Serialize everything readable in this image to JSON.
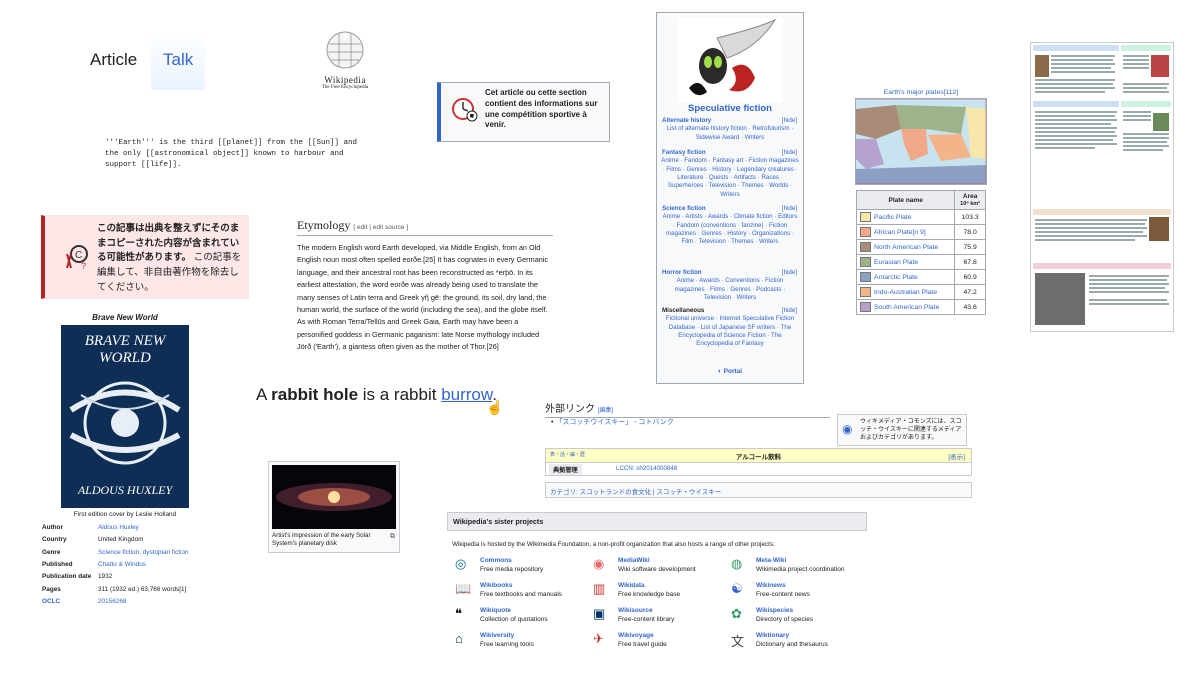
{
  "tabs": {
    "article": "Article",
    "talk": "Talk"
  },
  "wp_logo": {
    "name": "Wikipedia",
    "tagline": "The Free Encyclopedia"
  },
  "wikitext": "'''Earth''' is the third [[planet]] from the [[Sun]] and\nthe only [[astronomical object]] known to harbour and\nsupport [[life]].",
  "fr_notice": "Cet article ou cette section contient des informations sur une compétition sportive à venir.",
  "jp_notice": {
    "line1": "この記事は出典を整えずにそのままコピーされた内容が含まれている可能性があります。",
    "line2": "この記事を編集して、非自由著作物を除去してください。"
  },
  "etymology": {
    "heading": "Etymology",
    "edit": "[ edit | edit source ]",
    "text": "The modern English word Earth developed, via Middle English, from an Old English noun most often spelled eorðe.[25] It has cognates in every Germanic language, and their ancestral root has been reconstructed as *erþō. In its earliest attestation, the word eorðe was already being used to translate the many senses of Latin terra and Greek γῆ gē: the ground, its soil, dry land, the human world, the surface of the world (including the sea), and the globe itself. As with Roman Terra/Tellūs and Greek Gaia, Earth may have been a personified goddess in Germanic paganism: late Norse mythology included Jörð ('Earth'), a giantess often given as the mother of Thor.[26]"
  },
  "book": {
    "title": "Brave New World",
    "cover_top": "BRAVE NEW WORLD",
    "cover_author": "ALDOUS HUXLEY",
    "caption": "First edition cover by Leslie Holland",
    "rows": [
      {
        "k": "Author",
        "v": "Aldous Huxley",
        "link": true
      },
      {
        "k": "Country",
        "v": "United Kingdom",
        "link": false
      },
      {
        "k": "Genre",
        "v": "Science fiction, dystopian fiction",
        "link": true
      },
      {
        "k": "Published",
        "v": "Chatto & Windus",
        "link": true
      },
      {
        "k": "Publication date",
        "v": "1932",
        "link": false
      },
      {
        "k": "Pages",
        "v": "311 (1932 ed.) 63,766 words[1]",
        "link": false
      },
      {
        "k": "OCLC",
        "v": "20156268",
        "link": true
      }
    ]
  },
  "navbox": {
    "title": "Speculative fiction",
    "hide": "[hide]",
    "sections": [
      {
        "head": "Alternate history",
        "body": "List of alternate history fiction · Retrofuturism · Sidewise Award · Writers"
      },
      {
        "head": "Fantasy fiction",
        "body": "Anime · Fandom · Fantasy art · Fiction magazines · Films · Genres · History · Legendary creatures · Literature · Quests · Artifacts · Races · Superheroes · Television · Themes · Worlds · Writers"
      },
      {
        "head": "Science fiction",
        "body": "Anime · Artists · Awards · Climate fiction · Editors · Fandom (conventions · fanzine) · Fiction magazines · Genres · History · Organizations · Film · Television · Themes · Writers"
      },
      {
        "head": "Horror fiction",
        "body": "Anime · Awards · Conventions · Fiction magazines · Films · Genres · Podcasts · Television · Writers"
      },
      {
        "head": "Miscellaneous",
        "body": "Fictional universe · Internet Speculative Fiction Database · List of Japanese SF writers · The Encyclopedia of Science Fiction · The Encyclopedia of Fantasy"
      }
    ],
    "portal": "Portal"
  },
  "plates": {
    "caption": "Earth's major plates[112]",
    "col1": "Plate name",
    "col2": "Area",
    "col2_unit": "10⁶ km²",
    "rows": [
      {
        "name": "Pacific Plate",
        "area": "103.3",
        "color": "#f8e7a8"
      },
      {
        "name": "African Plate[n 9]",
        "area": "78.0",
        "color": "#f0a889"
      },
      {
        "name": "North American Plate",
        "area": "75.9",
        "color": "#a88c78"
      },
      {
        "name": "Eurasian Plate",
        "area": "67.8",
        "color": "#9fb38b"
      },
      {
        "name": "Antarctic Plate",
        "area": "60.9",
        "color": "#8c9fc4"
      },
      {
        "name": "Indo-Australian Plate",
        "area": "47.2",
        "color": "#f2b488"
      },
      {
        "name": "South American Plate",
        "area": "43.6",
        "color": "#b5a2cf"
      }
    ]
  },
  "rabbit": {
    "pre": "A ",
    "bold": "rabbit hole",
    "mid": " is a rabbit ",
    "link": "burrow",
    "post": "."
  },
  "thumb_caption": "Artist's impression of the early Solar System's planetary disk",
  "jp_ext": {
    "heading": "外部リンク",
    "edit": "[編集]",
    "bullet": "「スコッチウイスキー」 - コトバンク",
    "commons": "ウィキメディア・コモンズには、スコッチ・ウイスキーに関連するメディアおよびカテゴリがあります。",
    "authority_bar": "アルコール飲料",
    "authority_left": "表・話・編・歴",
    "show": "[表示]",
    "auth_label": "典拠管理",
    "lccn": "LCCN: sh2014000848",
    "category": "カテゴリ: スコットランドの食文化 | スコッチ・ウイスキー"
  },
  "sister": {
    "heading": "Wikipedia's sister projects",
    "intro": "Wikipedia is hosted by the Wikimedia Foundation, a non-profit organization that also hosts a range of other projects:",
    "items": [
      {
        "name": "Commons",
        "desc": "Free media repository"
      },
      {
        "name": "MediaWiki",
        "desc": "Wiki software development"
      },
      {
        "name": "Meta-Wiki",
        "desc": "Wikimedia project coordination"
      },
      {
        "name": "Wikibooks",
        "desc": "Free textbooks and manuals"
      },
      {
        "name": "Wikidata",
        "desc": "Free knowledge base"
      },
      {
        "name": "Wikinews",
        "desc": "Free-content news"
      },
      {
        "name": "Wikiquote",
        "desc": "Collection of quotations"
      },
      {
        "name": "Wikisource",
        "desc": "Free-content library"
      },
      {
        "name": "Wikispecies",
        "desc": "Directory of species"
      },
      {
        "name": "Wikiversity",
        "desc": "Free learning tools"
      },
      {
        "name": "Wikivoyage",
        "desc": "Free travel guide"
      },
      {
        "name": "Wiktionary",
        "desc": "Dictionary and thesaurus"
      }
    ]
  }
}
